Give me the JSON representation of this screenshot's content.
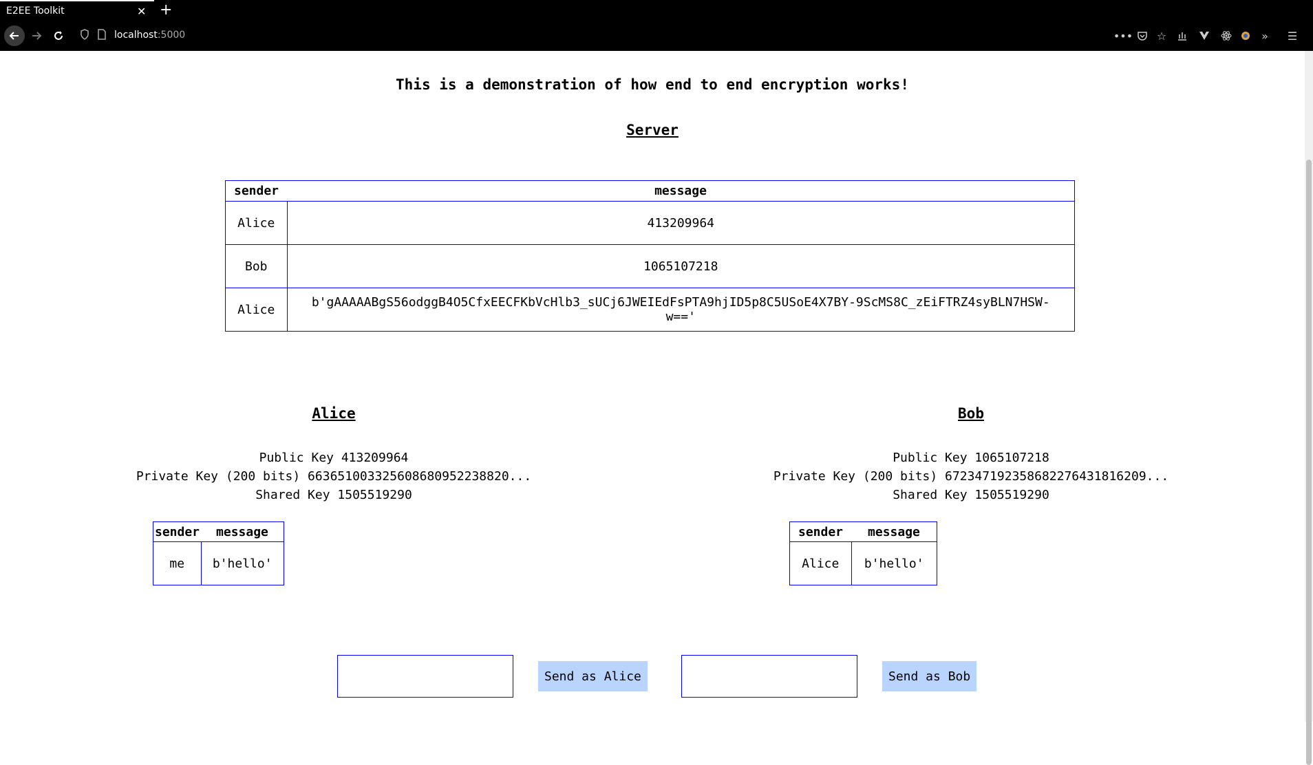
{
  "browser": {
    "tab_title": "E2EE Toolkit",
    "url_host": "localhost",
    "url_port": ":5000",
    "tab_close_glyph": "✕",
    "new_tab_glyph": "+"
  },
  "page": {
    "heading": "This is a demonstration of how end to end encryption works!",
    "server": {
      "title": "Server",
      "columns": [
        "sender",
        "message"
      ],
      "rows": [
        {
          "sender": "Alice",
          "message": "413209964"
        },
        {
          "sender": "Bob",
          "message": "1065107218"
        },
        {
          "sender": "Alice",
          "message": "b'gAAAAABgS56odggB4O5CfxEECFKbVcHlb3_sUCj6JWEIEdFsPTA9hjID5p8C5USoE4X7BY-9ScMS8C_zEiFTRZ4syBLN7HSW-w=='"
        }
      ]
    },
    "alice": {
      "title": "Alice",
      "public_key": "Public Key 413209964",
      "private_key": "Private Key (200 bits) 66365100332560868095223882​0...",
      "shared_key": "Shared Key 1505519290",
      "columns": [
        "sender",
        "message"
      ],
      "rows": [
        {
          "sender": "me",
          "message": "b'hello'"
        }
      ]
    },
    "bob": {
      "title": "Bob",
      "public_key": "Public Key 1065107218",
      "private_key": "Private Key (200 bits) 67234719235868227643181620​9...",
      "shared_key": "Shared Key 1505519290",
      "columns": [
        "sender",
        "message"
      ],
      "rows": [
        {
          "sender": "Alice",
          "message": "b'hello'"
        }
      ]
    },
    "controls": {
      "alice_input_value": "",
      "alice_button": "Send as Alice",
      "bob_input_value": "",
      "bob_button": "Send as Bob"
    }
  }
}
